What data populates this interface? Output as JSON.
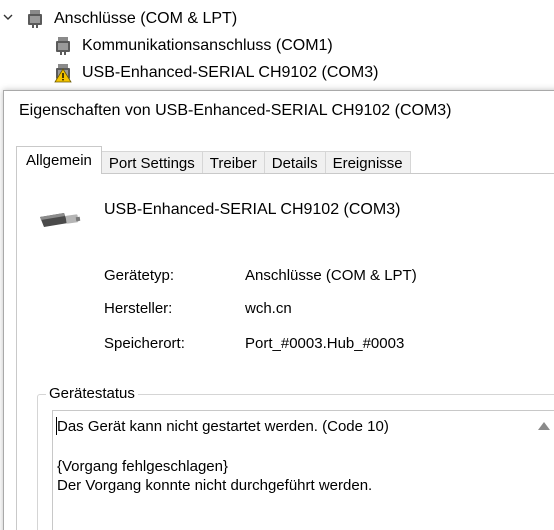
{
  "tree": {
    "category_label": "Anschlüsse (COM & LPT)",
    "items": [
      {
        "label": "Kommunikationsanschluss (COM1)",
        "icon": "com-port-icon"
      },
      {
        "label": "USB-Enhanced-SERIAL CH9102 (COM3)",
        "icon": "com-port-warning-icon"
      }
    ]
  },
  "dialog": {
    "title": "Eigenschaften von USB-Enhanced-SERIAL CH9102 (COM3)",
    "tabs": [
      "Allgemein",
      "Port Settings",
      "Treiber",
      "Details",
      "Ereignisse"
    ],
    "active_tab": "Allgemein",
    "device_name": "USB-Enhanced-SERIAL CH9102 (COM3)",
    "properties": [
      {
        "label": "Gerätetyp:",
        "value": "Anschlüsse (COM & LPT)"
      },
      {
        "label": "Hersteller:",
        "value": "wch.cn"
      },
      {
        "label": "Speicherort:",
        "value": "Port_#0003.Hub_#0003"
      }
    ],
    "status_group_label": "Gerätestatus",
    "status_lines": [
      "Das Gerät kann nicht gestartet werden. (Code 10)",
      "",
      "{Vorgang fehlgeschlagen}",
      "Der Vorgang konnte nicht durchgeführt werden."
    ]
  },
  "colors": {
    "warning": "#f5c400",
    "border": "#c9c9c9",
    "tab_inactive_bg": "#f0f0f0"
  }
}
